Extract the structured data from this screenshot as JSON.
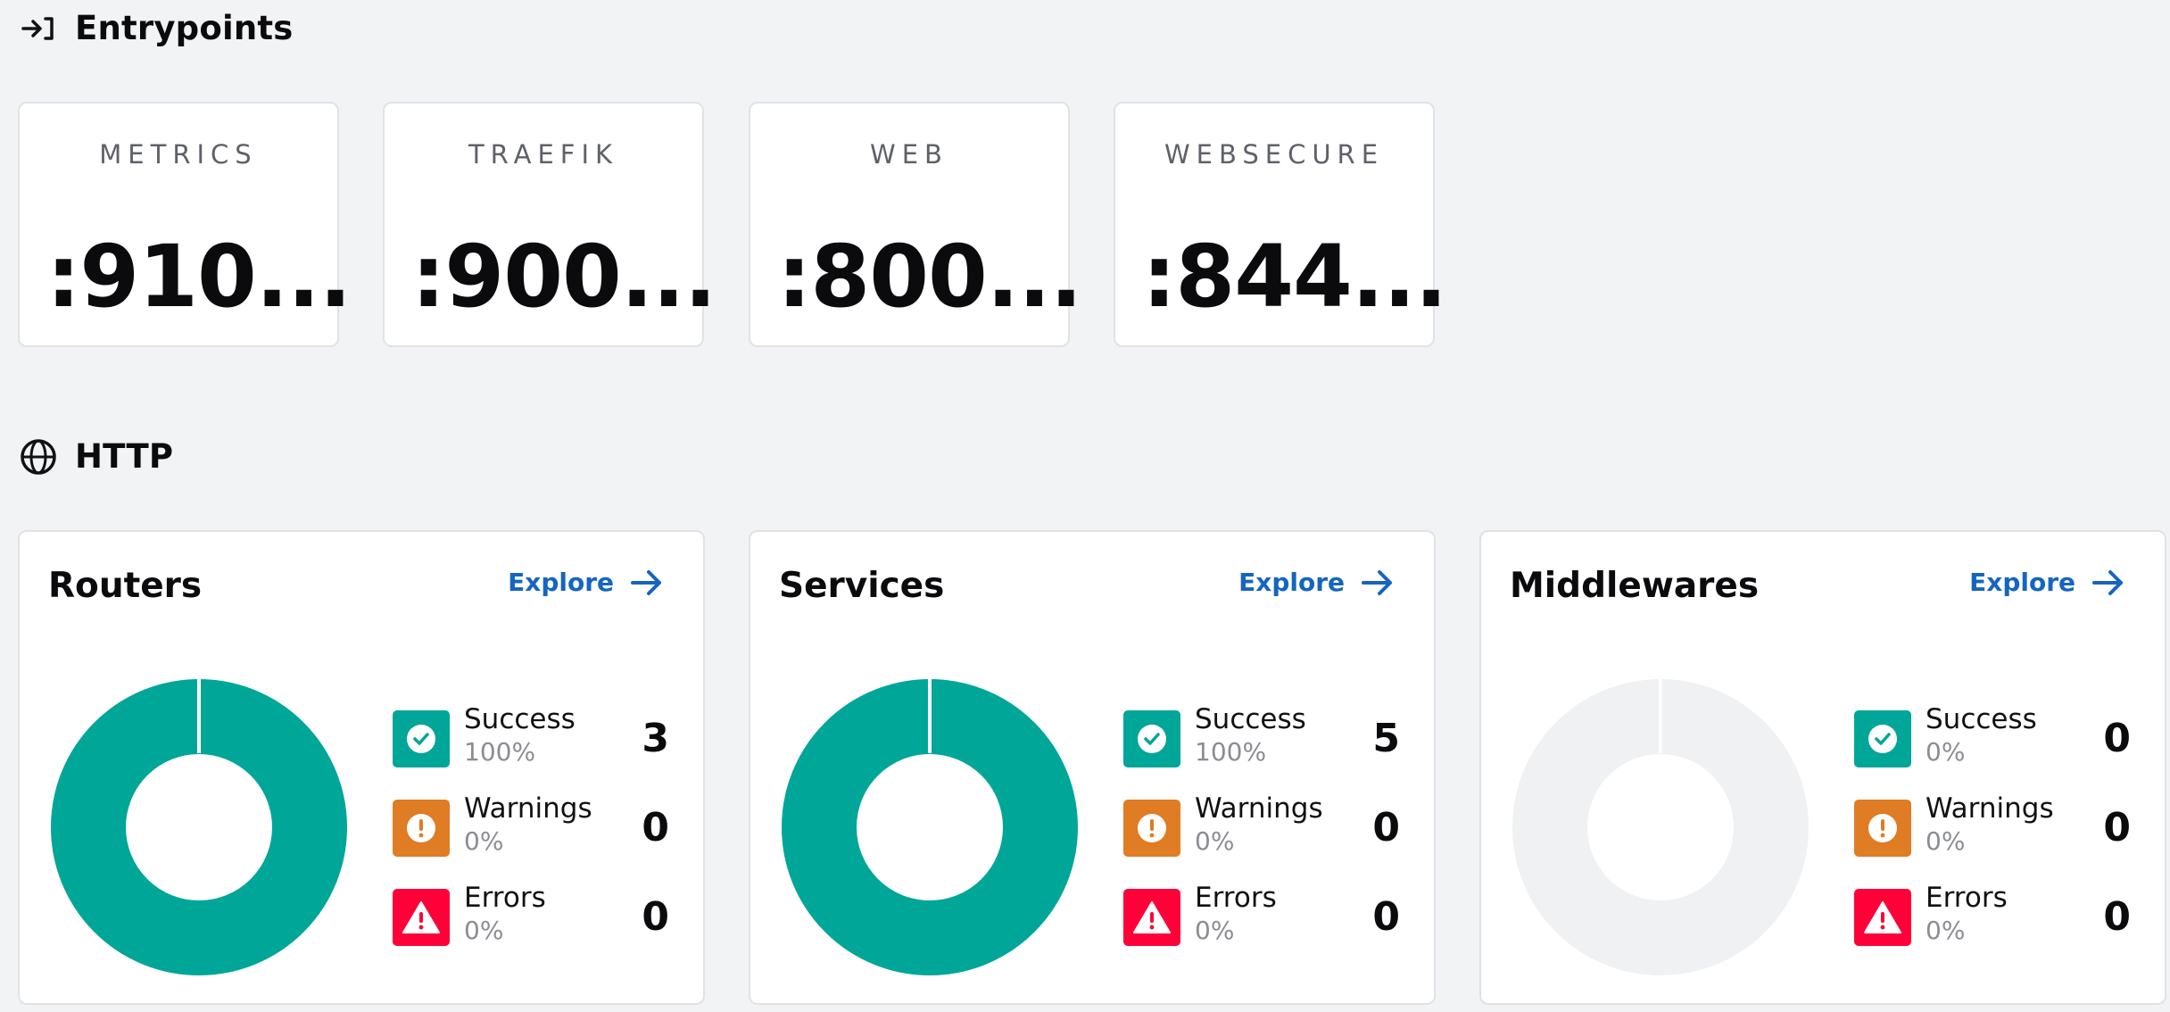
{
  "sections": {
    "entrypoints": {
      "title": "Entrypoints",
      "icon": "entry-arrow-icon"
    },
    "http": {
      "title": "HTTP",
      "icon": "globe-icon"
    }
  },
  "entrypoints": [
    {
      "name": "METRICS",
      "port": ":910..."
    },
    {
      "name": "TRAEFIK",
      "port": ":900..."
    },
    {
      "name": "WEB",
      "port": ":800..."
    },
    {
      "name": "WEBSECURE",
      "port": ":844..."
    }
  ],
  "http": {
    "explore_label": "Explore",
    "labels": {
      "success": "Success",
      "warnings": "Warnings",
      "errors": "Errors"
    },
    "cards": [
      {
        "title": "Routers",
        "success": {
          "count": "3",
          "pct": "100%"
        },
        "warnings": {
          "count": "0",
          "pct": "0%"
        },
        "errors": {
          "count": "0",
          "pct": "0%"
        }
      },
      {
        "title": "Services",
        "success": {
          "count": "5",
          "pct": "100%"
        },
        "warnings": {
          "count": "0",
          "pct": "0%"
        },
        "errors": {
          "count": "0",
          "pct": "0%"
        }
      },
      {
        "title": "Middlewares",
        "success": {
          "count": "0",
          "pct": "0%"
        },
        "warnings": {
          "count": "0",
          "pct": "0%"
        },
        "errors": {
          "count": "0",
          "pct": "0%"
        }
      }
    ]
  },
  "colors": {
    "success": "#00a697",
    "warning": "#e07c24",
    "error": "#ff0039",
    "empty_ring": "#f0f1f3",
    "link": "#1565c0"
  }
}
